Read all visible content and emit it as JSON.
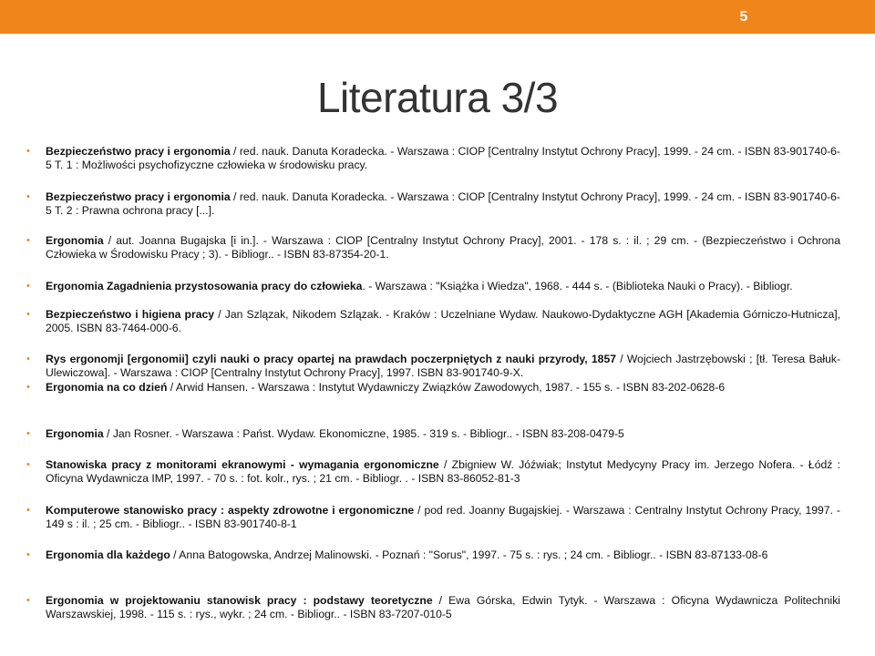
{
  "slide": {
    "number": "5",
    "title": "Literatura 3/3",
    "accent_color": "#f08519"
  },
  "references": [
    {
      "bold": "Bezpieczeństwo pracy i ergonomia",
      "text": " / red. nauk. Danuta Koradecka. - Warszawa : CIOP [Centralny Instytut Ochrony Pracy], 1999. - 24 cm. - ISBN 83-901740-6-5 T. 1 : Możliwości psychofizyczne człowieka w środowisku pracy."
    },
    {
      "bold": "Bezpieczeństwo pracy i ergonomia",
      "text": " / red. nauk. Danuta Koradecka. - Warszawa : CIOP [Centralny Instytut Ochrony Pracy], 1999. - 24 cm. - ISBN 83-901740-6-5 T. 2 : Prawna ochrona pracy [...]."
    },
    {
      "bold": "Ergonomia",
      "text": " / aut. Joanna Bugajska [i in.]. - Warszawa : CIOP [Centralny Instytut Ochrony Pracy], 2001. - 178 s. : il. ; 29 cm. - (Bezpieczeństwo i Ochrona Człowieka w Środowisku Pracy ; 3). - Bibliogr.. - ISBN 83-87354-20-1."
    },
    {
      "bold": "Ergonomia Zagadnienia przystosowania pracy do człowieka",
      "text": ". - Warszawa : \"Książka i Wiedza\", 1968. - 444 s. - (Biblioteka Nauki o Pracy). - Bibliogr."
    },
    {
      "bold": "Bezpieczeństwo i higiena pracy",
      "text": " / Jan Szlązak, Nikodem Szlązak. - Kraków : Uczelniane Wydaw. Naukowo-Dydaktyczne AGH [Akademia Górniczo-Hutnicza], 2005. ISBN 83-7464-000-6."
    },
    {
      "bold": "Rys ergonomji [ergonomii] czyli nauki o pracy opartej na prawdach poczerpniętych z nauki przyrody, 1857",
      "text": " / Wojciech Jastrzębowski ; [tł. Teresa Bałuk-Ulewiczowa]. - Warszawa : CIOP [Centralny Instytut Ochrony Pracy], 1997. ISBN 83-901740-9-X."
    },
    {
      "bold": "Ergonomia na co dzień",
      "text": " / Arwid Hansen. - Warszawa : Instytut Wydawniczy Związków Zawodowych, 1987. - 155 s. - ISBN 83-202-0628-6"
    },
    {
      "bold": "Ergonomia",
      "text": " / Jan Rosner. - Warszawa : Państ. Wydaw. Ekonomiczne, 1985. - 319 s. - Bibliogr.. - ISBN 83-208-0479-5"
    },
    {
      "bold": "Stanowiska pracy z monitorami ekranowymi - wymagania ergonomiczne",
      "text": " / Zbigniew W. Jóźwiak; Instytut Medycyny Pracy im. Jerzego Nofera. - Łódź : Oficyna Wydawnicza IMP, 1997. - 70 s. : fot. kolr., rys. ; 21 cm. - Bibliogr. . - ISBN 83-86052-81-3"
    },
    {
      "bold": "Komputerowe stanowisko pracy : aspekty zdrowotne i ergonomiczne",
      "text": " / pod red. Joanny Bugajskiej. - Warszawa : Centralny Instytut Ochrony Pracy, 1997. - 149 s : il. ; 25 cm. - Bibliogr.. - ISBN 83-901740-8-1"
    },
    {
      "bold": "Ergonomia dla każdego",
      "text": " / Anna Batogowska, Andrzej Malinowski. - Poznań : \"Sorus\", 1997. - 75 s. : rys. ; 24 cm. - Bibliogr.. - ISBN 83-87133-08-6"
    },
    {
      "bold": "Ergonomia w projektowaniu stanowisk pracy : podstawy teoretyczne",
      "text": " / Ewa Górska, Edwin Tytyk. - Warszawa : Oficyna Wydawnicza Politechniki Warszawskiej, 1998. - 115 s. : rys., wykr. ; 24 cm. - Bibliogr.. - ISBN 83-7207-010-5"
    }
  ]
}
